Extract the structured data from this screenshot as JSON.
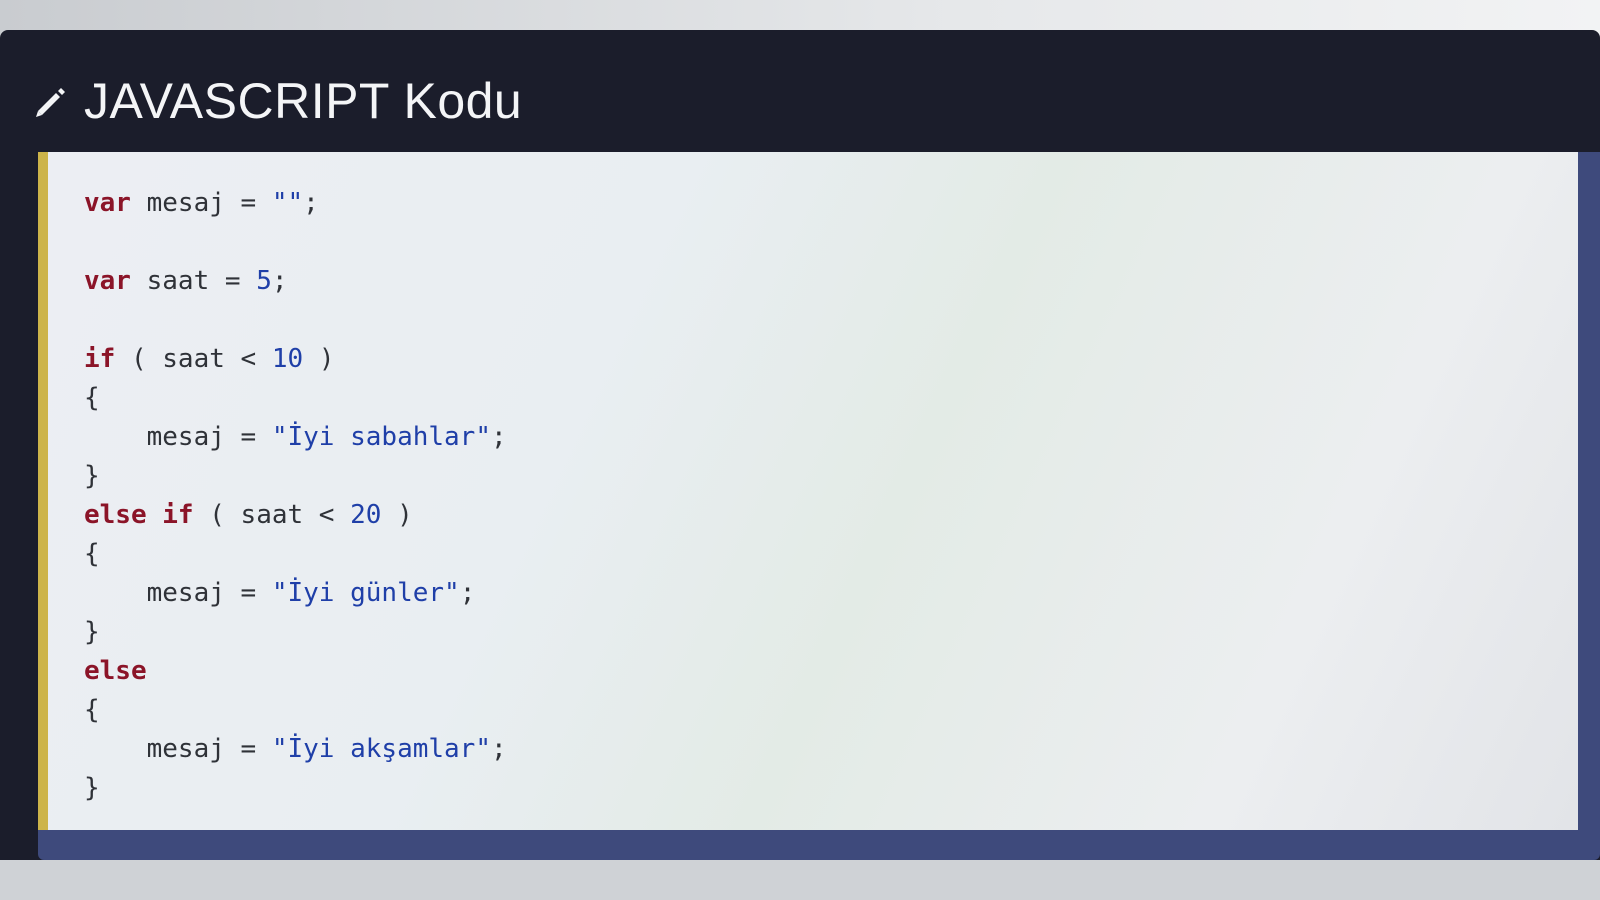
{
  "header": {
    "title": "JAVASCRIPT Kodu",
    "icon": "pencil-icon"
  },
  "colors": {
    "header_bg": "#1b1d2b",
    "accent_border": "#cdb44a",
    "keyword": "#8b1428",
    "string": "#1f3fa8"
  },
  "code": {
    "language": "javascript",
    "lines": [
      [
        {
          "t": "kw",
          "v": "var"
        },
        {
          "t": "txt",
          "v": " mesaj = "
        },
        {
          "t": "str",
          "v": "\"\""
        },
        {
          "t": "txt",
          "v": ";"
        }
      ],
      [],
      [
        {
          "t": "kw",
          "v": "var"
        },
        {
          "t": "txt",
          "v": " saat = "
        },
        {
          "t": "num",
          "v": "5"
        },
        {
          "t": "txt",
          "v": ";"
        }
      ],
      [],
      [
        {
          "t": "kw",
          "v": "if"
        },
        {
          "t": "txt",
          "v": " ( saat < "
        },
        {
          "t": "num",
          "v": "10"
        },
        {
          "t": "txt",
          "v": " )"
        }
      ],
      [
        {
          "t": "txt",
          "v": "{"
        }
      ],
      [
        {
          "t": "txt",
          "v": "    mesaj = "
        },
        {
          "t": "str",
          "v": "\"İyi sabahlar\""
        },
        {
          "t": "txt",
          "v": ";"
        }
      ],
      [
        {
          "t": "txt",
          "v": "}"
        }
      ],
      [
        {
          "t": "kw",
          "v": "else if"
        },
        {
          "t": "txt",
          "v": " ( saat < "
        },
        {
          "t": "num",
          "v": "20"
        },
        {
          "t": "txt",
          "v": " )"
        }
      ],
      [
        {
          "t": "txt",
          "v": "{"
        }
      ],
      [
        {
          "t": "txt",
          "v": "    mesaj = "
        },
        {
          "t": "str",
          "v": "\"İyi günler\""
        },
        {
          "t": "txt",
          "v": ";"
        }
      ],
      [
        {
          "t": "txt",
          "v": "}"
        }
      ],
      [
        {
          "t": "kw",
          "v": "else"
        }
      ],
      [
        {
          "t": "txt",
          "v": "{"
        }
      ],
      [
        {
          "t": "txt",
          "v": "    mesaj = "
        },
        {
          "t": "str",
          "v": "\"İyi akşamlar\""
        },
        {
          "t": "txt",
          "v": ";"
        }
      ],
      [
        {
          "t": "txt",
          "v": "}"
        }
      ]
    ]
  }
}
